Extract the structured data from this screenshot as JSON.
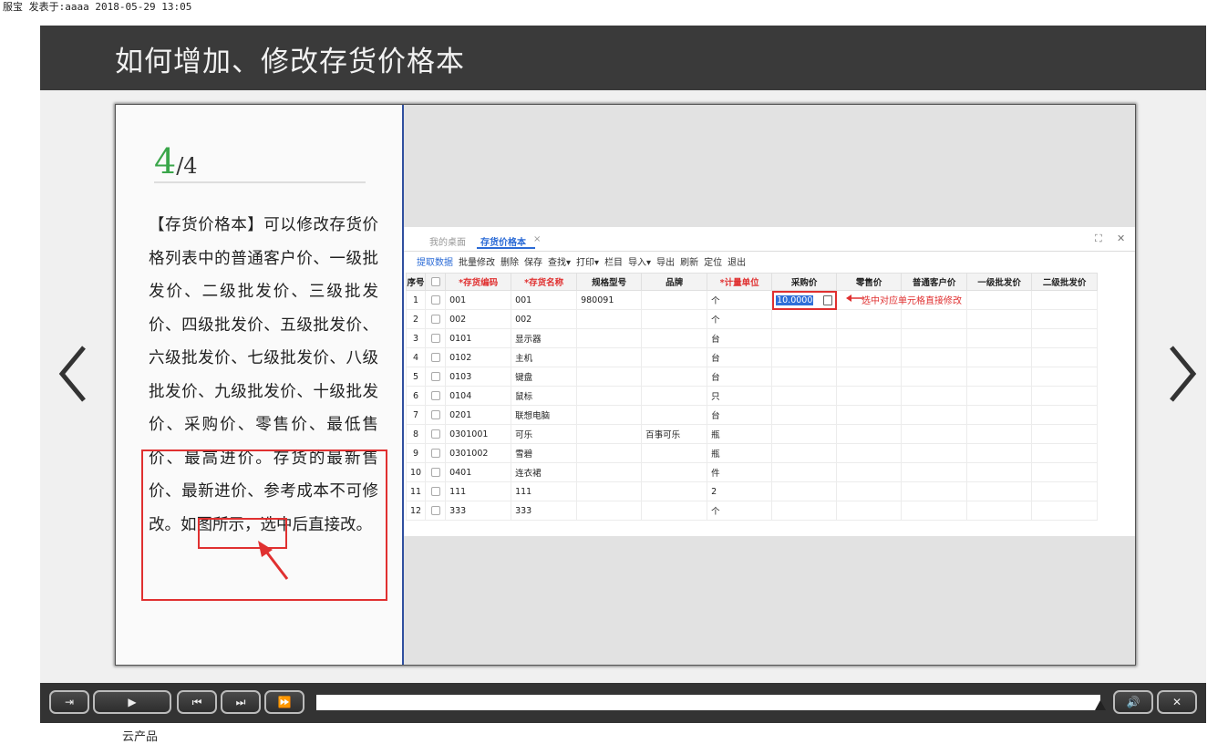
{
  "post_meta": "服宝 发表于:aaaa 2018-05-29 13:05",
  "slide_title": "如何增加、修改存货价格本",
  "page": {
    "current": "4",
    "total": "/4"
  },
  "description": "【存货价格本】可以修改存货价格列表中的普通客户价、一级批发价、二级批发价、三级批发价、四级批发价、五级批发价、六级批发价、七级批发价、八级批发价、九级批发价、十级批发价、采购价、零售价、最低售价、最高进价。存货的最新售价、最新进价、参考成本不可修改。如图所示，选中后直接改。",
  "app": {
    "tabs": [
      "我的桌面",
      "存货价格本"
    ],
    "tab_close": "×",
    "toolbar": [
      "提取数据",
      "批量修改",
      "删除",
      "保存",
      "查找▾",
      "打印▾",
      "栏目",
      "导入▾",
      "导出",
      "刷新",
      "定位",
      "退出"
    ],
    "columns": [
      "序号",
      "",
      "*存货编码",
      "*存货名称",
      "规格型号",
      "品牌",
      "*计量单位",
      "采购价",
      "零售价",
      "普通客户价",
      "一级批发价",
      "二级批发价"
    ],
    "rows": [
      [
        "1",
        "001",
        "001",
        "980091",
        "",
        "个"
      ],
      [
        "2",
        "002",
        "002",
        "",
        "",
        "个"
      ],
      [
        "3",
        "0101",
        "显示器",
        "",
        "",
        "台"
      ],
      [
        "4",
        "0102",
        "主机",
        "",
        "",
        "台"
      ],
      [
        "5",
        "0103",
        "键盘",
        "",
        "",
        "台"
      ],
      [
        "6",
        "0104",
        "鼠标",
        "",
        "",
        "只"
      ],
      [
        "7",
        "0201",
        "联想电脑",
        "",
        "",
        "台"
      ],
      [
        "8",
        "0301001",
        "可乐",
        "",
        "百事可乐",
        "瓶"
      ],
      [
        "9",
        "0301002",
        "雪碧",
        "",
        "",
        "瓶"
      ],
      [
        "10",
        "0401",
        "连衣裙",
        "",
        "",
        "件"
      ],
      [
        "11",
        "111",
        "111",
        "",
        "",
        "2"
      ],
      [
        "12",
        "333",
        "333",
        "",
        "",
        "个"
      ]
    ],
    "edit_value": "10.0000",
    "annotation": "选中对应单元格直接修改"
  },
  "player": {
    "progress": 0.99
  },
  "footer_text": "云产品",
  "colors": {
    "highlight": "#e03030",
    "accent": "#2b6bd6",
    "page_number": "#3aa64a"
  }
}
